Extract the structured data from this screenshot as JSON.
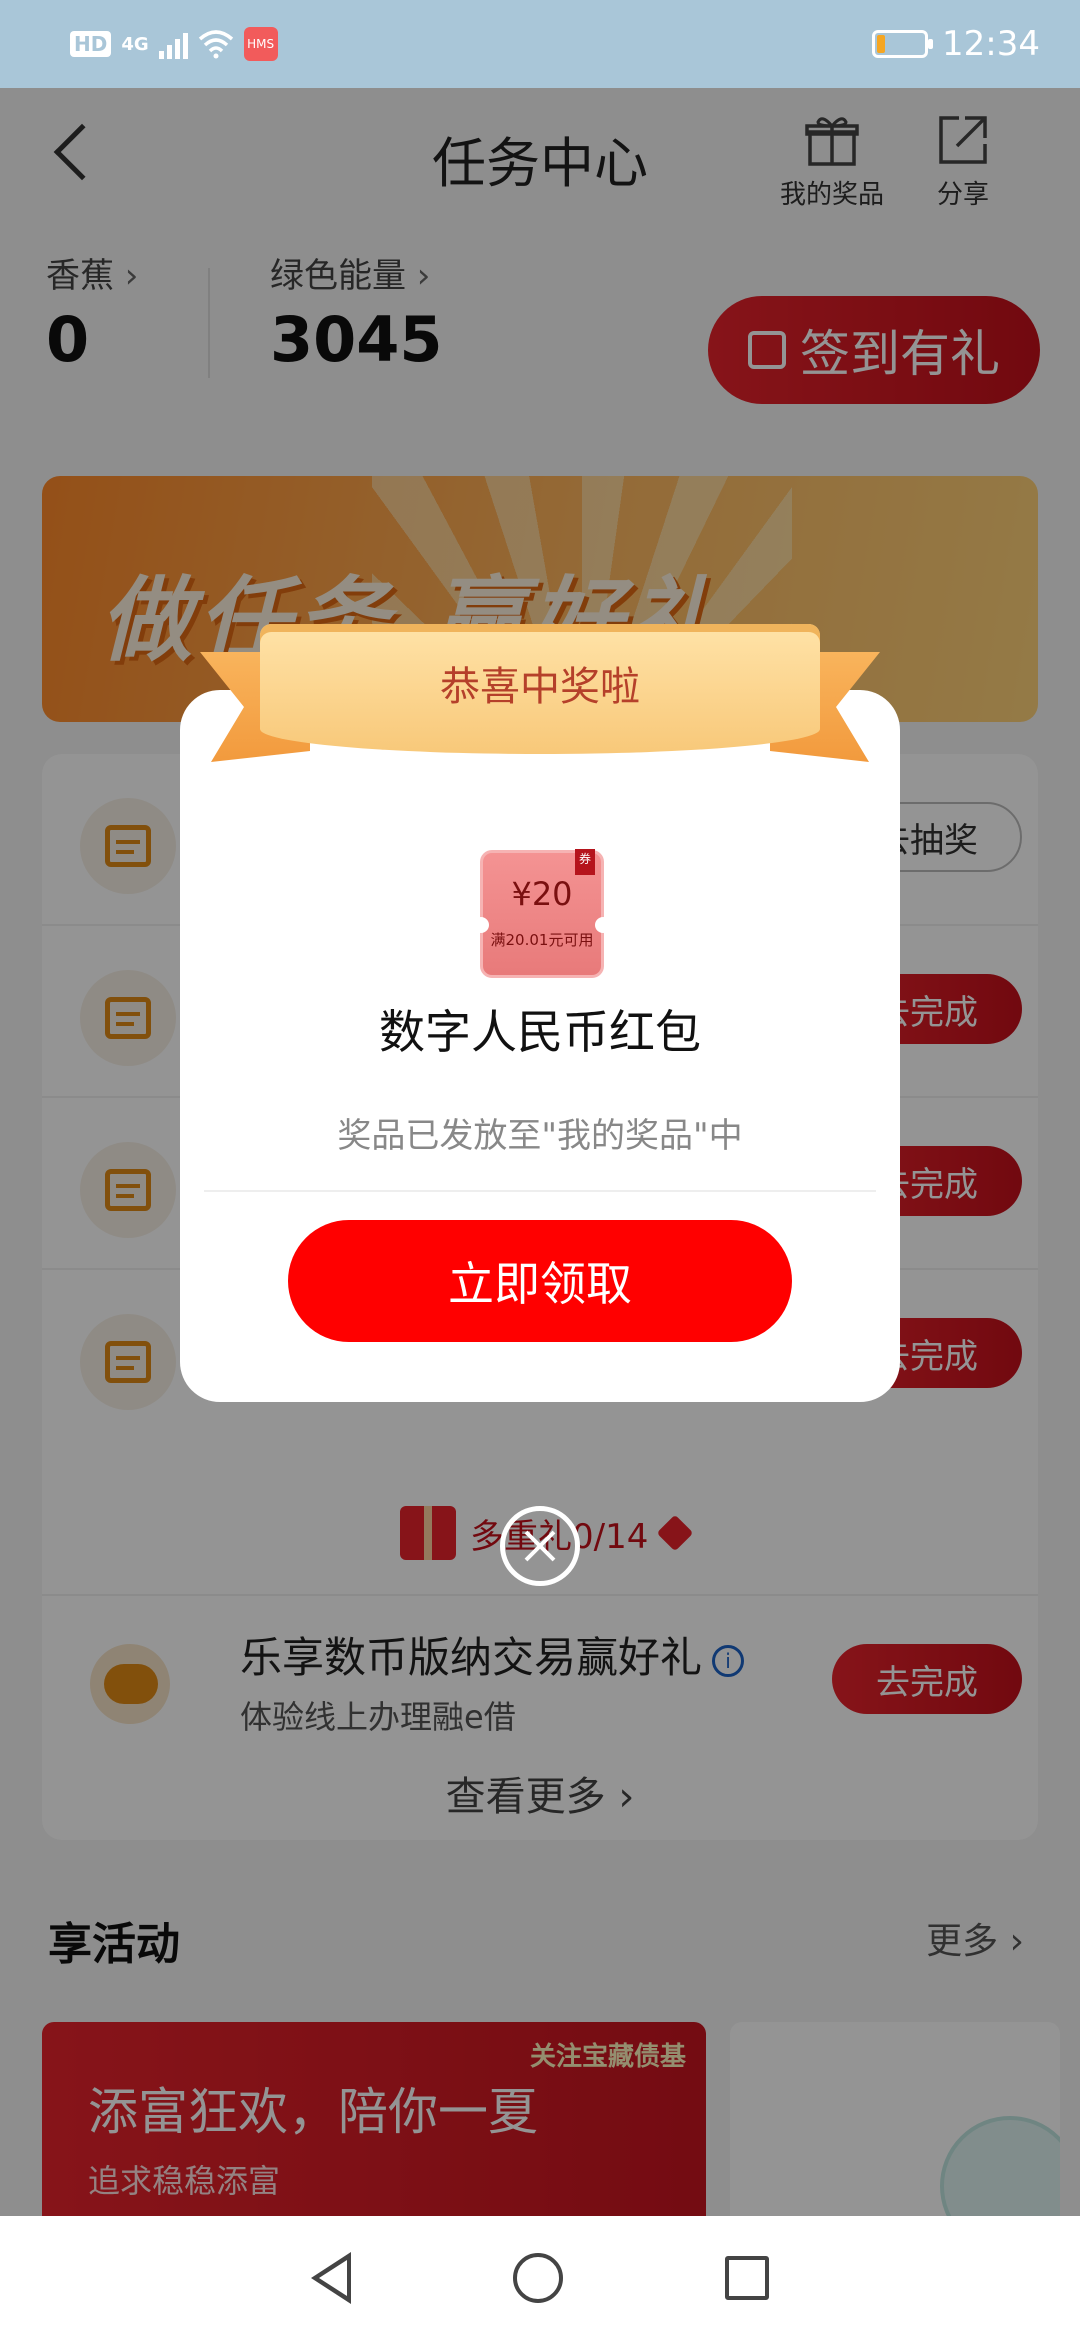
{
  "status_bar": {
    "hd": "HD",
    "network": "4G",
    "hms": "HMS",
    "time": "12:34",
    "battery_level": 0.15
  },
  "header": {
    "title": "任务中心",
    "prizes_label": "我的奖品",
    "share_label": "分享"
  },
  "stats": {
    "banana_label": "香蕉",
    "banana_value": "0",
    "energy_label": "绿色能量",
    "energy_value": "3045",
    "signin_label": "签到有礼"
  },
  "banner": {
    "text": "做任务 赢好礼"
  },
  "tasks": {
    "buttons": [
      "去抽奖",
      "去完成",
      "去完成",
      "去完成"
    ],
    "multi_gift": "多重礼0/14",
    "pig_title": "乐享数币版纳交易赢好礼",
    "pig_sub": "体验线上办理融e借",
    "pig_button": "去完成",
    "more": "查看更多"
  },
  "activities": {
    "title": "享活动",
    "more": "更多",
    "promo_title": "添富狂欢，陪你一夏",
    "promo_sub": "追求稳稳添富",
    "promo_tag": "关注宝藏债基"
  },
  "modal": {
    "ribbon": "恭喜中奖啦",
    "coupon_amount": "¥20",
    "coupon_condition": "满20.01元可用",
    "coupon_tag": "券",
    "prize_name": "数字人民币红包",
    "prize_note": "奖品已发放至\"我的奖品\"中",
    "claim_label": "立即领取"
  },
  "colors": {
    "brand_red": "#e8232c",
    "claim_red": "#ff0000",
    "status_bar": "#a9c6d8"
  }
}
